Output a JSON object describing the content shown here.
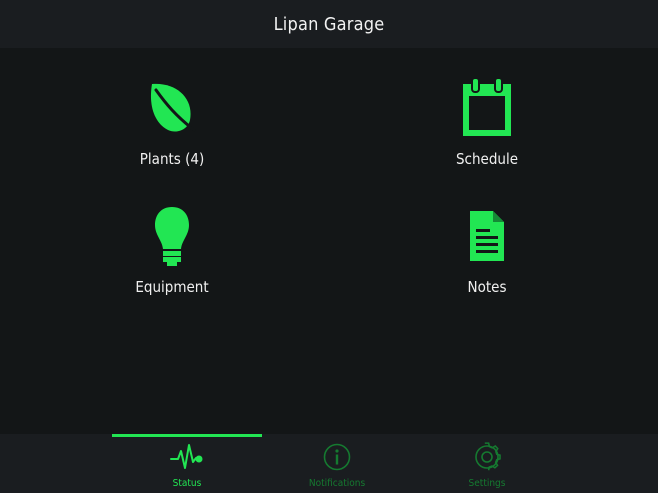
{
  "header": {
    "title": "Lipan Garage"
  },
  "tiles": [
    {
      "label": "Plants (4)",
      "icon": "leaf-icon"
    },
    {
      "label": "Schedule",
      "icon": "calendar-icon"
    },
    {
      "label": "Equipment",
      "icon": "lightbulb-icon"
    },
    {
      "label": "Notes",
      "icon": "document-icon"
    }
  ],
  "bottom_nav": {
    "active": "Status",
    "items": [
      {
        "label": "Status",
        "icon": "pulse-icon"
      },
      {
        "label": "Notifications",
        "icon": "info-icon"
      },
      {
        "label": "Settings",
        "icon": "gear-icon"
      }
    ]
  },
  "colors": {
    "accent": "#22e653",
    "accent_dim": "#157a30",
    "background": "#131617",
    "bar": "#1a1d20",
    "text": "#f0f0f0"
  }
}
